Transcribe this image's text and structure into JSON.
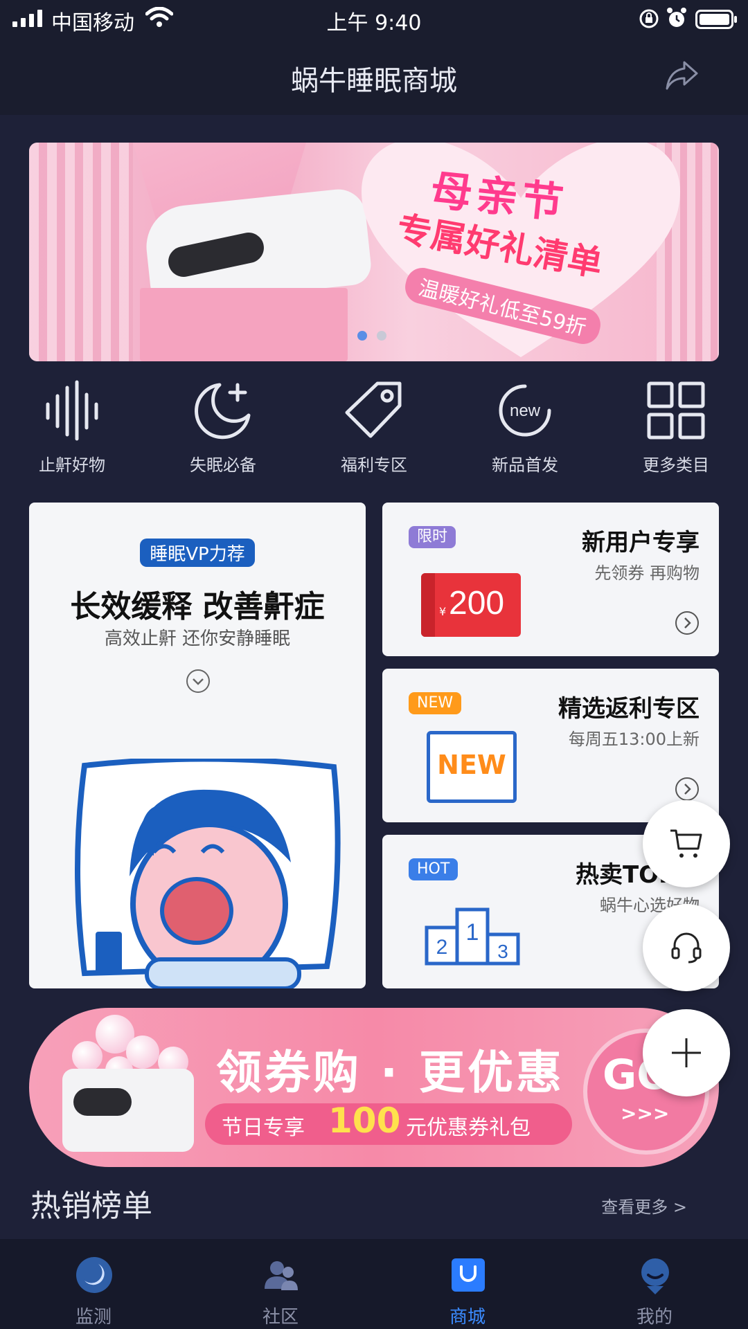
{
  "status_bar": {
    "carrier": "中国移动",
    "time": "上午 9:40"
  },
  "nav": {
    "title": "蜗牛睡眠商城"
  },
  "banner": {
    "headline": "母亲节",
    "subheadline": "专属好礼清单",
    "tagline": "温暖好礼低至59折",
    "page_count": 2,
    "current_page": 1
  },
  "categories": [
    {
      "label": "止鼾好物",
      "icon": "sound-wave-icon"
    },
    {
      "label": "失眠必备",
      "icon": "moon-plus-icon"
    },
    {
      "label": "福利专区",
      "icon": "tag-icon"
    },
    {
      "label": "新品首发",
      "icon": "new-badge-icon",
      "icon_text": "new"
    },
    {
      "label": "更多类目",
      "icon": "grid-icon"
    }
  ],
  "feature_card": {
    "tag": "睡眠VP力荐",
    "headline": "长效缓释 改善鼾症",
    "subtitle": "高效止鼾 还你安静睡眠"
  },
  "small_cards": [
    {
      "badge": "限时",
      "badge_color": "#8e7bd6",
      "title": "新用户专享",
      "subtitle": "先领券 再购物",
      "coupon_symbol": "¥",
      "coupon_value": "200"
    },
    {
      "badge": "NEW",
      "badge_color": "#ff9a1a",
      "title": "精选返利专区",
      "subtitle": "每周五13:00上新",
      "illus_text": "NEW"
    },
    {
      "badge": "HOT",
      "badge_color": "#3a7ee8",
      "title": "热卖TOP榜",
      "subtitle": "蜗牛心选好物"
    }
  ],
  "promo": {
    "headline": "领券购 · 更优惠",
    "line_prefix": "节日专享",
    "amount": "100",
    "line_suffix": "元优惠券礼包",
    "go_label": "GO",
    "go_arrows": ">>>"
  },
  "hot_list": {
    "title": "热销榜单",
    "see_more": "查看更多 >"
  },
  "tabs": [
    {
      "label": "监测",
      "icon": "moon-circle-icon",
      "active": false
    },
    {
      "label": "社区",
      "icon": "people-icon",
      "active": false
    },
    {
      "label": "商城",
      "icon": "shopping-bag-icon",
      "active": true
    },
    {
      "label": "我的",
      "icon": "profile-icon",
      "active": false
    }
  ],
  "colors": {
    "accent": "#3b8bff",
    "background": "#1e2138",
    "promo_pink": "#f68aa8"
  }
}
